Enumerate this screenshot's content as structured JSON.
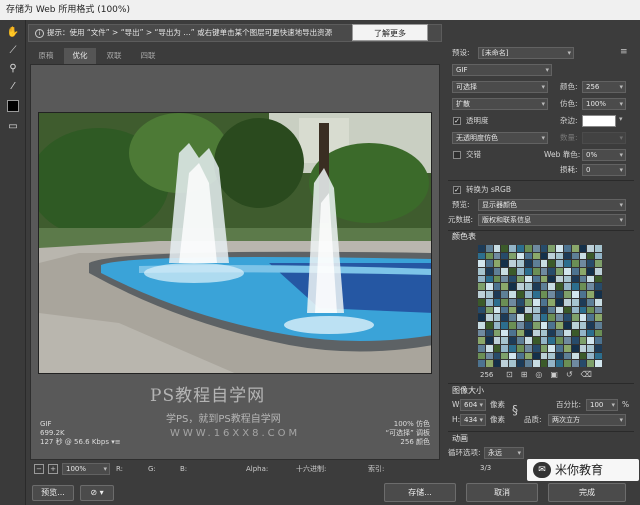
{
  "window": {
    "title": "存储为 Web 所用格式 (100%)"
  },
  "toolbar": {
    "tools": [
      "hand-icon",
      "slice-icon",
      "zoom-icon",
      "eyedropper-icon",
      "color-swatch",
      "toggle-slices-icon"
    ]
  },
  "tip": {
    "text": "提示：使用 “文件” > “导出” > “导出为 …” 或右键单击某个图层可更快速地导出资源",
    "learn_more": "了解更多"
  },
  "tabs": [
    "原稿",
    "优化",
    "双联",
    "四联"
  ],
  "image_info": {
    "left": [
      "GIF",
      "699.2K",
      "127 秒 @ 56.6 Kbps ▾≡"
    ],
    "right": [
      "100% 仿色",
      "“可选择” 调板",
      "256 颜色"
    ]
  },
  "watermark": {
    "line1": "PS教程自学网",
    "line2": "学PS，就到PS教程自学网",
    "line3": "WWW.16XX8.COM"
  },
  "statusbar": {
    "zoom": "100%",
    "r": "R:",
    "g": "G:",
    "b": "B:",
    "alpha": "Alpha:",
    "hex": "十六进制:",
    "index": "索引:"
  },
  "bottom": {
    "preview": "预览...",
    "save": "存储...",
    "cancel": "取消",
    "done": "完成"
  },
  "settings": {
    "preset_label": "预设:",
    "preset": "[未命名]",
    "format": "GIF",
    "reduction": "可选择",
    "colors_label": "颜色:",
    "colors": "256",
    "dither_algo": "扩散",
    "dither_label": "仿色:",
    "dither": "100%",
    "transparency_label": "透明度",
    "matte_label": "杂边:",
    "trans_dither": "无透明度仿色",
    "amount_label": "数量:",
    "interlaced_label": "交错",
    "web_snap_label": "Web 靠色:",
    "web_snap": "0%",
    "lossy_label": "损耗:",
    "lossy": "0",
    "convert_srgb_label": "转换为 sRGB",
    "preview_label": "预览:",
    "preview_value": "显示器颜色",
    "metadata_label": "元数据:",
    "metadata_value": "版权和联系信息"
  },
  "color_table": {
    "title": "颜色表",
    "count": "256"
  },
  "image_size": {
    "title": "图像大小",
    "w_label": "W:",
    "w": "604",
    "h_label": "H:",
    "h": "434",
    "unit": "像素",
    "percent_label": "百分比:",
    "percent": "100",
    "pct_sign": "%",
    "quality_label": "品质:",
    "quality": "两次立方"
  },
  "animation": {
    "title": "动画",
    "loop_label": "循环选项:",
    "loop": "永远",
    "frame": "3/3"
  },
  "logo": {
    "text": "米你教育"
  },
  "colors": {
    "accent_button": "#f3f3f3",
    "panel_bg": "#3c3c3c",
    "water": "#3aa3d8"
  },
  "swatch_colors": [
    "#1d3b57",
    "#6f8aa0",
    "#bcd0d8",
    "#2c6e8e",
    "#8ba86a",
    "#3b5a2a",
    "#d2e6ee",
    "#5e7f96",
    "#274b6a",
    "#a6c4cf",
    "#6b8f55",
    "#14304a",
    "#93b5c8",
    "#4d7390",
    "#c8dde3",
    "#7ea06a"
  ]
}
